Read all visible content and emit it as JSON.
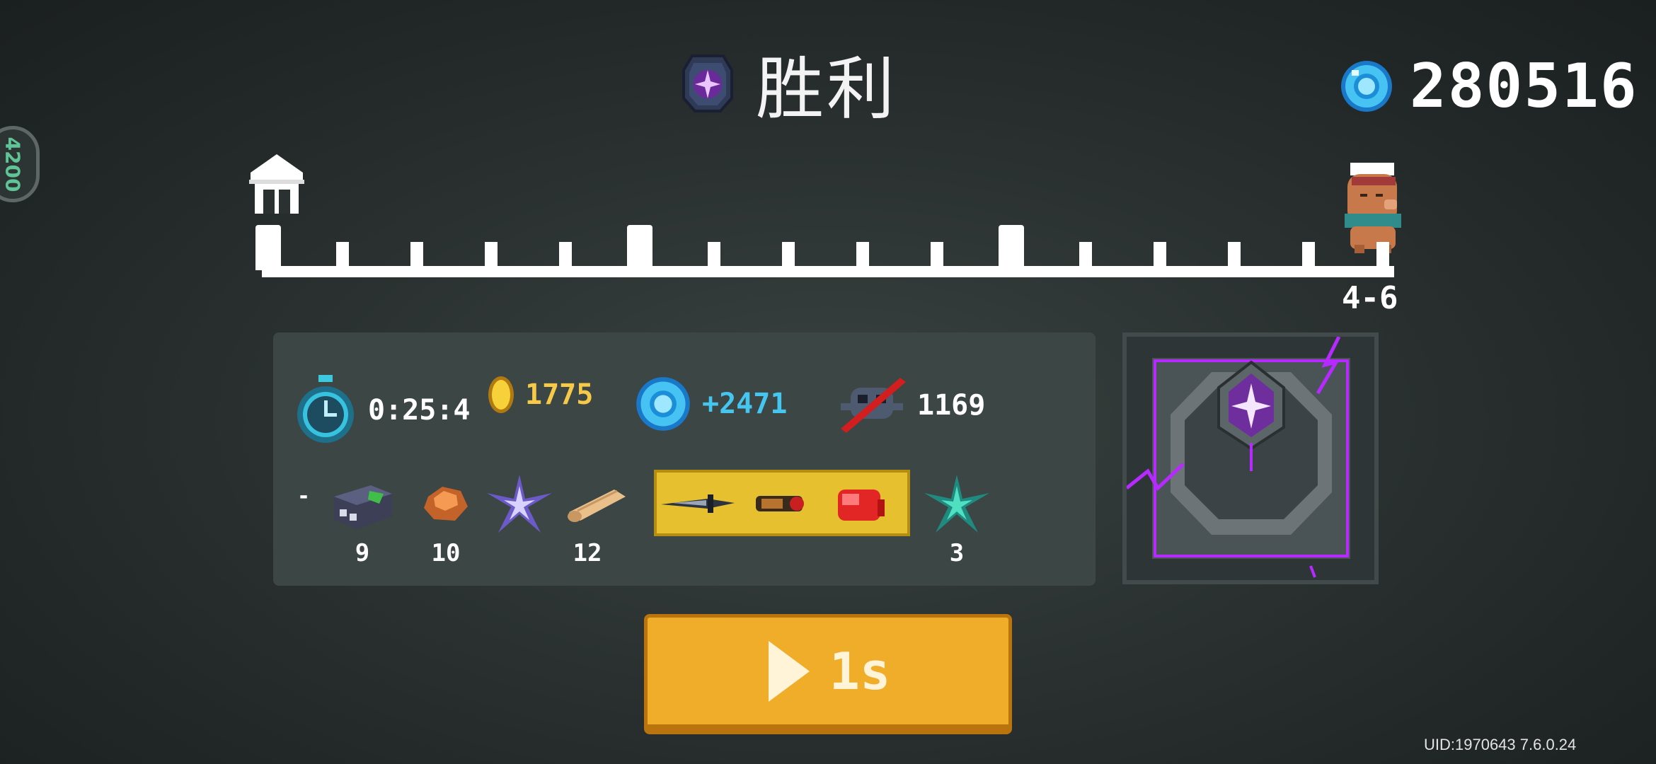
{
  "header": {
    "title": "胜利",
    "title_icon": "dark-crystal-icon",
    "gem_total": "280516",
    "gem_icon": "blue-gem-icon"
  },
  "side_badge": {
    "text": "4200"
  },
  "progress": {
    "home_icon": "home-icon",
    "avatar_icon": "capybara-avatar-icon",
    "stage_label": "4-6",
    "completed_fraction": 1.0
  },
  "stats": {
    "time": "0:25:4",
    "gold": "1775",
    "gems": "+2471",
    "kills": "1169"
  },
  "loot": [
    {
      "icon": "dark-block-icon",
      "count": "9"
    },
    {
      "icon": "copper-ore-icon",
      "count": "10"
    },
    {
      "icon": "purple-shard-icon",
      "count": ""
    },
    {
      "icon": "wood-log-icon",
      "count": "12"
    },
    {
      "icon": "dagger-icon",
      "count": ""
    },
    {
      "icon": "scope-icon",
      "count": ""
    },
    {
      "icon": "red-glove-icon",
      "count": ""
    },
    {
      "icon": "green-shard-icon",
      "count": "3"
    }
  ],
  "reward": {
    "icon": "crystal-chest-icon"
  },
  "play_button": {
    "label": "1s"
  },
  "footer": {
    "uid": "UID:1970643 7.6.0.24"
  },
  "colors": {
    "accent": "#f0ad2a",
    "gold": "#f7c948",
    "gem": "#45c6f0",
    "panel": "#3b4645",
    "purple": "#b629ff"
  }
}
